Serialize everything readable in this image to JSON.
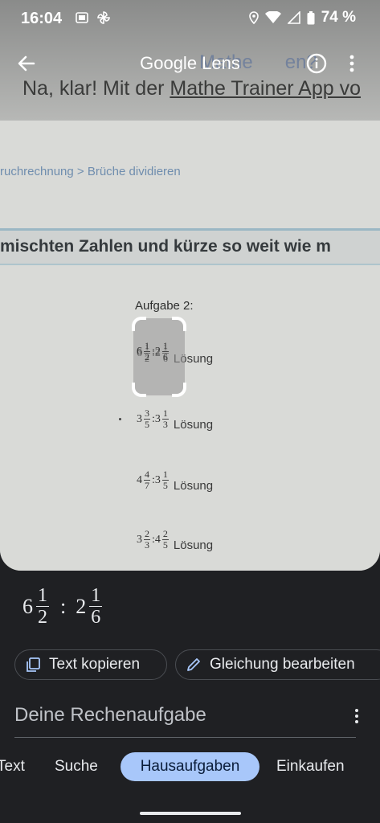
{
  "status_bar": {
    "time": "16:04",
    "battery": "74 %",
    "icons": [
      "sim-card-icon",
      "pinwheel-icon",
      "location-icon",
      "wifi-icon",
      "signal-icon",
      "battery-icon"
    ]
  },
  "app_bar": {
    "title": "Google Lens",
    "icons": [
      "back-arrow-icon",
      "info-icon",
      "more-vert-icon"
    ]
  },
  "camera_preview": {
    "ghost_title": "Mathe",
    "ghost_end": "en?",
    "headline_prefix": "Na, klar! Mit der ",
    "headline_link": "Mathe Trainer App vo",
    "breadcrumb": "ruchrechnung > Brüche dividieren",
    "band_text": "mischten Zahlen und kürze so weit wie m",
    "task_label": "Aufgabe 2:",
    "solution_label": "Lösung",
    "problems": [
      {
        "w1": "6",
        "n1": "1",
        "d1": "2",
        "w2": "2",
        "n2": "1",
        "d2": "6"
      },
      {
        "w1": "3",
        "n1": "3",
        "d1": "5",
        "w2": "3",
        "n2": "1",
        "d2": "3"
      },
      {
        "w1": "4",
        "n1": "4",
        "d1": "7",
        "w2": "3",
        "n2": "1",
        "d2": "5"
      },
      {
        "w1": "3",
        "n1": "2",
        "d1": "3",
        "w2": "4",
        "n2": "2",
        "d2": "5"
      }
    ]
  },
  "result": {
    "whole1": "6",
    "num1": "1",
    "den1": "2",
    "operator": ":",
    "whole2": "2",
    "num2": "1",
    "den2": "6"
  },
  "actions": {
    "copy_label": "Text kopieren",
    "edit_label": "Gleichung bearbeiten"
  },
  "section": {
    "title": "Deine Rechenaufgabe"
  },
  "tabs": [
    {
      "label": "Text",
      "selected": false
    },
    {
      "label": "Suche",
      "selected": false
    },
    {
      "label": "Hausaufgaben",
      "selected": true
    },
    {
      "label": "Einkaufen",
      "selected": false
    }
  ],
  "colors": {
    "background": "#1f2023",
    "selected_tab": "#a8c7fa"
  }
}
